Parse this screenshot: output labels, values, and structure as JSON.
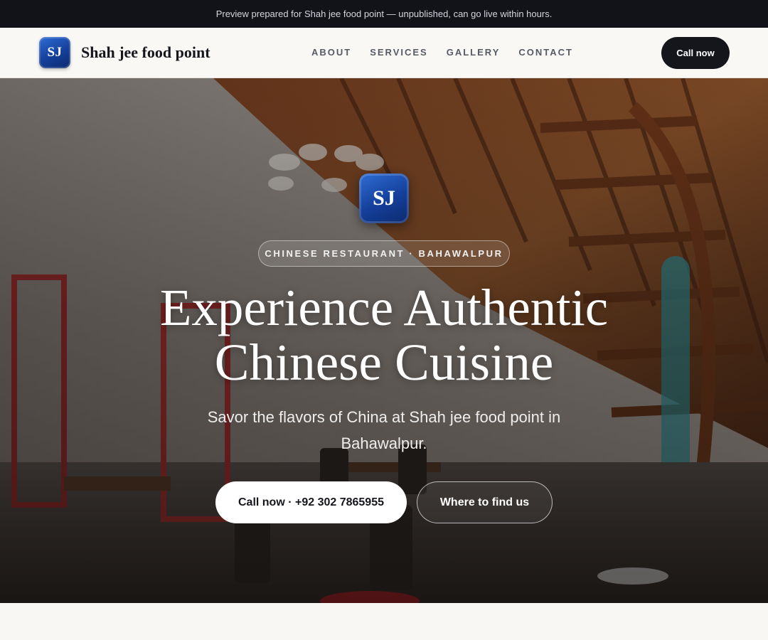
{
  "preview_banner": {
    "text": "Preview prepared for Shah jee food point — unpublished, can go live within hours."
  },
  "header": {
    "logo_initials": "SJ",
    "brand_name": "Shah jee food point",
    "nav": [
      {
        "label": "ABOUT"
      },
      {
        "label": "SERVICES"
      },
      {
        "label": "GALLERY"
      },
      {
        "label": "CONTACT"
      }
    ],
    "cta_label": "Call now"
  },
  "hero": {
    "logo_initials": "SJ",
    "tagline": "CHINESE RESTAURANT · BAHAWALPUR",
    "title_line1": "Experience Authentic",
    "title_line2": "Chinese Cuisine",
    "subtitle": "Savor the flavors of China at Shah jee food point in Bahawalpur.",
    "primary_button": "Call now · +92 302 7865955",
    "secondary_button": "Where to find us"
  },
  "colors": {
    "top_bar": "#111319",
    "nav_background": "#f9f8f5",
    "cta_dark": "#14161b",
    "logo_blue": "#143f9a",
    "page_background": "#f8f7f3"
  }
}
